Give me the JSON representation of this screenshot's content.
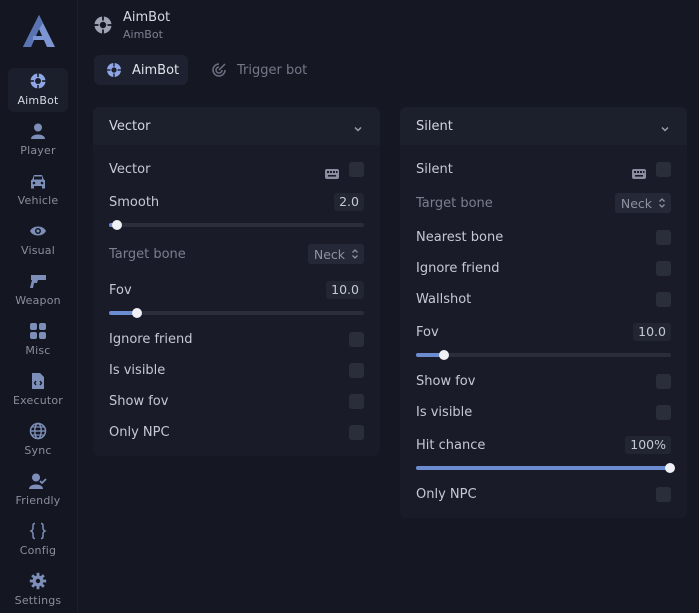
{
  "sidebar": {
    "logo_letter": "A",
    "items": [
      {
        "label": "AimBot",
        "icon": "crosshair-icon",
        "active": true
      },
      {
        "label": "Player",
        "icon": "user-icon"
      },
      {
        "label": "Vehicle",
        "icon": "car-icon"
      },
      {
        "label": "Visual",
        "icon": "eye-icon"
      },
      {
        "label": "Weapon",
        "icon": "gun-icon"
      },
      {
        "label": "Misc",
        "icon": "grid-icon"
      },
      {
        "label": "Executor",
        "icon": "file-code-icon"
      },
      {
        "label": "Sync",
        "icon": "globe-icon"
      },
      {
        "label": "Friendly",
        "icon": "user-check-icon"
      },
      {
        "label": "Config",
        "icon": "braces-icon"
      },
      {
        "label": "Settings",
        "icon": "gear-icon"
      }
    ]
  },
  "header": {
    "title": "AimBot",
    "subtitle": "AimBot",
    "icon": "crosshair-icon"
  },
  "tabs": [
    {
      "label": "AimBot",
      "icon": "crosshair-icon",
      "active": true
    },
    {
      "label": "Trigger bot",
      "icon": "radar-icon",
      "active": false
    }
  ],
  "vector_panel": {
    "title": "Vector",
    "enable_label": "Vector",
    "smooth_label": "Smooth",
    "smooth_value": "2.0",
    "smooth_fraction": 0.03,
    "target_bone_label": "Target bone",
    "target_bone_value": "Neck",
    "fov_label": "Fov",
    "fov_value": "10.0",
    "fov_fraction": 0.11,
    "ignore_friend_label": "Ignore friend",
    "is_visible_label": "Is visible",
    "show_fov_label": "Show fov",
    "only_npc_label": "Only NPC"
  },
  "silent_panel": {
    "title": "Silent",
    "enable_label": "Silent",
    "target_bone_label": "Target bone",
    "target_bone_value": "Neck",
    "nearest_bone_label": "Nearest bone",
    "ignore_friend_label": "Ignore friend",
    "wallshot_label": "Wallshot",
    "fov_label": "Fov",
    "fov_value": "10.0",
    "fov_fraction": 0.11,
    "show_fov_label": "Show fov",
    "is_visible_label": "Is visible",
    "hit_chance_label": "Hit chance",
    "hit_chance_value": "100%",
    "hit_chance_fraction": 1.0,
    "only_npc_label": "Only NPC"
  },
  "colors": {
    "accent": "#6b8cd0",
    "background": "#151823",
    "panel": "#191c28"
  }
}
